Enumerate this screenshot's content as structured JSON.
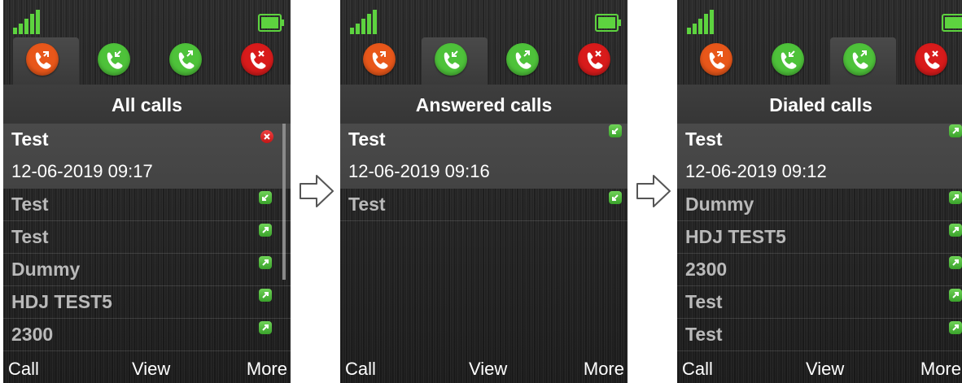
{
  "colors": {
    "signal": "#5dd33f",
    "battery": "#5dd33f",
    "tab_all": "#e8571a",
    "tab_answered": "#4ec23a",
    "tab_dialed": "#4ec23a",
    "tab_missed": "#d81b1b",
    "indicator_green": "#4ec23a",
    "indicator_red": "#d81b1b"
  },
  "tabs": [
    {
      "icon": "all-calls-icon"
    },
    {
      "icon": "answered-calls-icon"
    },
    {
      "icon": "dialed-calls-icon"
    },
    {
      "icon": "missed-calls-icon"
    }
  ],
  "softkeys": {
    "left": "Call",
    "center": "View",
    "right": "More"
  },
  "screens": [
    {
      "active_tab": 0,
      "title": "All calls",
      "selected": {
        "name": "Test",
        "datetime": "12-06-2019 09:17",
        "type": "missed"
      },
      "rows": [
        {
          "name": "Test",
          "type": "answered"
        },
        {
          "name": "Test",
          "type": "dialed"
        },
        {
          "name": "Dummy",
          "type": "dialed"
        },
        {
          "name": "HDJ TEST5",
          "type": "dialed"
        },
        {
          "name": "2300",
          "type": "dialed"
        }
      ]
    },
    {
      "active_tab": 1,
      "title": "Answered calls",
      "selected": {
        "name": "Test",
        "datetime": "12-06-2019 09:16",
        "type": "answered"
      },
      "rows": [
        {
          "name": "Test",
          "type": "answered"
        }
      ]
    },
    {
      "active_tab": 2,
      "title": "Dialed calls",
      "selected": {
        "name": "Test",
        "datetime": "12-06-2019 09:12",
        "type": "dialed"
      },
      "rows": [
        {
          "name": "Dummy",
          "type": "dialed"
        },
        {
          "name": "HDJ TEST5",
          "type": "dialed"
        },
        {
          "name": "2300",
          "type": "dialed"
        },
        {
          "name": "Test",
          "type": "dialed"
        },
        {
          "name": "Test",
          "type": "dialed"
        }
      ]
    }
  ]
}
